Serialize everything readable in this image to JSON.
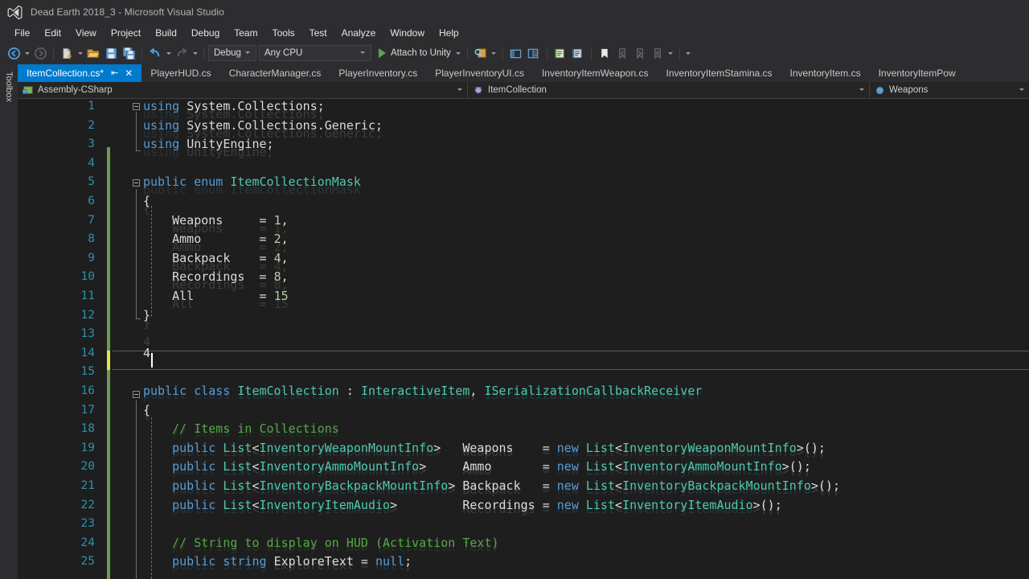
{
  "window": {
    "title": "Dead Earth 2018_3 - Microsoft Visual Studio",
    "logo_icon": "visual-studio-logo-icon"
  },
  "menu": {
    "items": [
      {
        "label": "File"
      },
      {
        "label": "Edit"
      },
      {
        "label": "View"
      },
      {
        "label": "Project"
      },
      {
        "label": "Build"
      },
      {
        "label": "Debug"
      },
      {
        "label": "Team"
      },
      {
        "label": "Tools"
      },
      {
        "label": "Test"
      },
      {
        "label": "Analyze"
      },
      {
        "label": "Window"
      },
      {
        "label": "Help"
      }
    ]
  },
  "toolbar": {
    "nav_back_icon": "navigate-back-icon",
    "nav_forward_icon": "navigate-forward-icon",
    "new_item_icon": "new-item-icon",
    "open_file_icon": "open-file-icon",
    "save_icon": "save-icon",
    "save_all_icon": "save-all-icon",
    "undo_icon": "undo-icon",
    "redo_icon": "redo-icon",
    "configuration": {
      "value": "Debug",
      "dropdown_icon": "chevron-down-icon"
    },
    "platform": {
      "value": "Any CPU",
      "dropdown_icon": "chevron-down-icon"
    },
    "run": {
      "label": "Attach to Unity",
      "play_icon": "play-icon",
      "dropdown_icon": "chevron-down-icon"
    },
    "find_icon": "find-in-files-icon",
    "solution_explorer_icon": "solution-explorer-icon",
    "properties_icon": "properties-window-icon",
    "comment_icon": "comment-selection-icon",
    "uncomment_icon": "uncomment-selection-icon",
    "bookmark_icon": "bookmark-icon",
    "prev_bookmark_icon": "previous-bookmark-icon",
    "next_bookmark_icon": "next-bookmark-icon",
    "clear_bookmarks_icon": "clear-bookmarks-icon",
    "overflow_icon": "toolbar-overflow-icon"
  },
  "toolbox": {
    "label": "Toolbox",
    "icon": "toolbox-icon"
  },
  "tabs": [
    {
      "label": "ItemCollection.cs*",
      "active": true,
      "pin_icon": "pin-icon",
      "close_icon": "close-icon"
    },
    {
      "label": "PlayerHUD.cs",
      "active": false
    },
    {
      "label": "CharacterManager.cs",
      "active": false
    },
    {
      "label": "PlayerInventory.cs",
      "active": false
    },
    {
      "label": "PlayerInventoryUI.cs",
      "active": false
    },
    {
      "label": "InventoryItemWeapon.cs",
      "active": false
    },
    {
      "label": "InventoryItemStamina.cs",
      "active": false
    },
    {
      "label": "InventoryItem.cs",
      "active": false
    },
    {
      "label": "InventoryItemPow",
      "active": false
    }
  ],
  "navbar": {
    "project": {
      "label": "Assembly-CSharp",
      "icon": "csharp-project-icon",
      "dropdown_icon": "chevron-down-icon"
    },
    "type": {
      "label": "ItemCollection",
      "icon": "class-icon",
      "dropdown_icon": "chevron-down-icon"
    },
    "member": {
      "label": "Weapons",
      "icon": "field-icon",
      "dropdown_icon": "chevron-down-icon"
    }
  },
  "editor": {
    "language": "csharp",
    "caret_line": 14,
    "caret_column": 2,
    "first_visible_line": 1,
    "line_numbers": [
      1,
      2,
      3,
      4,
      5,
      6,
      7,
      8,
      9,
      10,
      11,
      12,
      13,
      14,
      15,
      16,
      17,
      18,
      19,
      20,
      21,
      22,
      23,
      24,
      25
    ],
    "lines": [
      {
        "num": 1,
        "text": "using System.Collections;"
      },
      {
        "num": 2,
        "text": "using System.Collections.Generic;"
      },
      {
        "num": 3,
        "text": "using UnityEngine;"
      },
      {
        "num": 4,
        "text": ""
      },
      {
        "num": 5,
        "text": "public enum ItemCollectionMask"
      },
      {
        "num": 6,
        "text": "{"
      },
      {
        "num": 7,
        "text": "    Weapons     = 1,"
      },
      {
        "num": 8,
        "text": "    Ammo        = 2,"
      },
      {
        "num": 9,
        "text": "    Backpack    = 4,"
      },
      {
        "num": 10,
        "text": "    Recordings  = 8,"
      },
      {
        "num": 11,
        "text": "    All         = 15"
      },
      {
        "num": 12,
        "text": "}"
      },
      {
        "num": 13,
        "text": ""
      },
      {
        "num": 14,
        "text": "4"
      },
      {
        "num": 15,
        "text": ""
      },
      {
        "num": 16,
        "text": "public class ItemCollection : InteractiveItem, ISerializationCallbackReceiver"
      },
      {
        "num": 17,
        "text": "{"
      },
      {
        "num": 18,
        "text": "    // Items in Collections"
      },
      {
        "num": 19,
        "text": "    public List<InventoryWeaponMountInfo>   Weapons    = new List<InventoryWeaponMountInfo>();"
      },
      {
        "num": 20,
        "text": "    public List<InventoryAmmoMountInfo>     Ammo       = new List<InventoryAmmoMountInfo>();"
      },
      {
        "num": 21,
        "text": "    public List<InventoryBackpackMountInfo> Backpack   = new List<InventoryBackpackMountInfo>();"
      },
      {
        "num": 22,
        "text": "    public List<InventoryItemAudio>         Recordings = new List<InventoryItemAudio>();"
      },
      {
        "num": 23,
        "text": ""
      },
      {
        "num": 24,
        "text": "    // String to display on HUD (Activation Text)"
      },
      {
        "num": 25,
        "text": "    public string ExploreText = null;"
      }
    ]
  },
  "colors": {
    "accent": "#007acc",
    "editor_background": "#1e1e1e",
    "chrome_background": "#2d2d30",
    "line_number": "#2b91af",
    "keyword": "#569cd6",
    "type": "#4ec9b0",
    "number": "#b5cea8",
    "comment": "#57a64a",
    "plain_text": "#dcdcdc",
    "change_bar_saved": "#6a9d4f",
    "change_bar_unsaved": "#e5e54b"
  }
}
